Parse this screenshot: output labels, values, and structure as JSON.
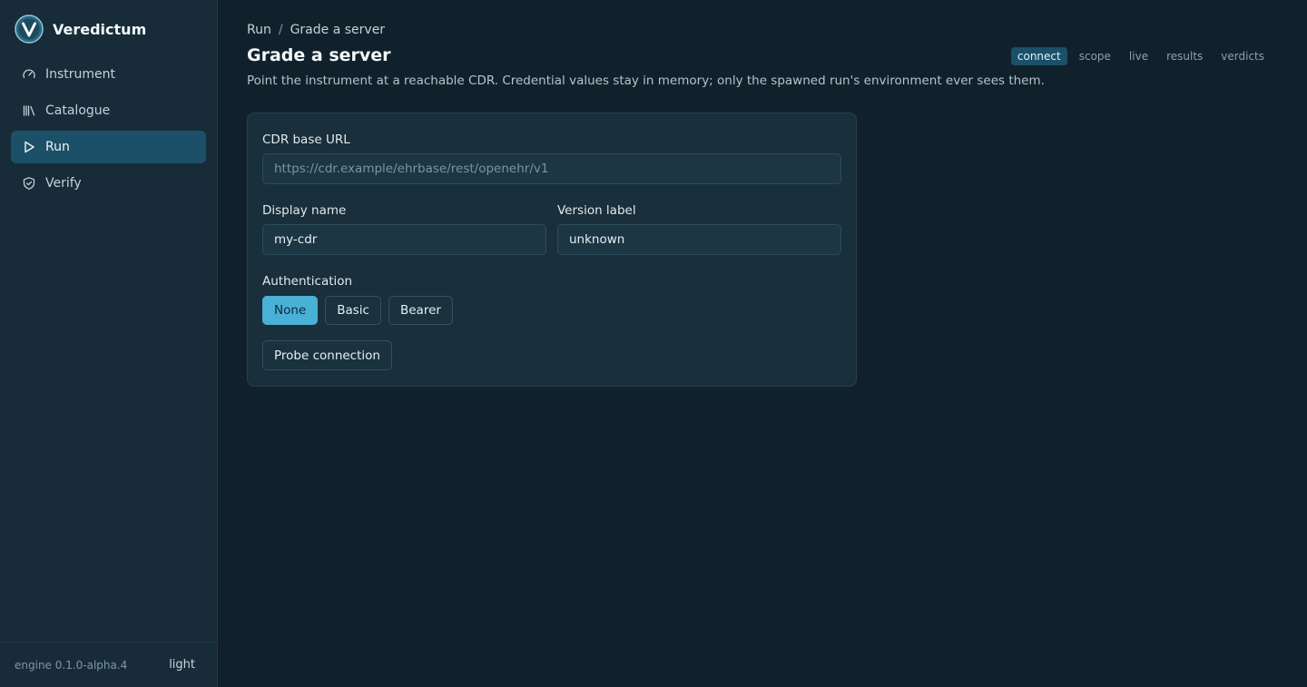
{
  "app": {
    "name": "Veredictum",
    "logo_icon": "veredictum-logo-icon"
  },
  "sidebar": {
    "items": [
      {
        "label": "Instrument",
        "icon": "gauge-icon",
        "active": false
      },
      {
        "label": "Catalogue",
        "icon": "library-icon",
        "active": false
      },
      {
        "label": "Run",
        "icon": "play-icon",
        "active": true
      },
      {
        "label": "Verify",
        "icon": "shield-check-icon",
        "active": false
      }
    ],
    "footer": {
      "engine_version": "engine 0.1.0-alpha.4",
      "theme_toggle": "light"
    }
  },
  "breadcrumb": {
    "parent": "Run",
    "separator": "/",
    "current": "Grade a server"
  },
  "page": {
    "title": "Grade a server",
    "subtitle": "Point the instrument at a reachable CDR. Credential values stay in memory; only the spawned run's environment ever sees them."
  },
  "steps": [
    {
      "label": "connect",
      "active": true
    },
    {
      "label": "scope",
      "active": false
    },
    {
      "label": "live",
      "active": false
    },
    {
      "label": "results",
      "active": false
    },
    {
      "label": "verdicts",
      "active": false
    }
  ],
  "form": {
    "cdr_url": {
      "label": "CDR base URL",
      "value": "",
      "placeholder": "https://cdr.example/ehrbase/rest/openehr/v1"
    },
    "display_name": {
      "label": "Display name",
      "value": "my-cdr"
    },
    "version_label": {
      "label": "Version label",
      "value": "unknown"
    },
    "authentication": {
      "label": "Authentication",
      "options": [
        "None",
        "Basic",
        "Bearer"
      ],
      "selected": "None"
    },
    "probe_button": "Probe connection"
  },
  "colors": {
    "accent": "#49b0d6",
    "active_nav": "#1b5068",
    "background": "#11212c",
    "sidebar": "#172c38"
  }
}
